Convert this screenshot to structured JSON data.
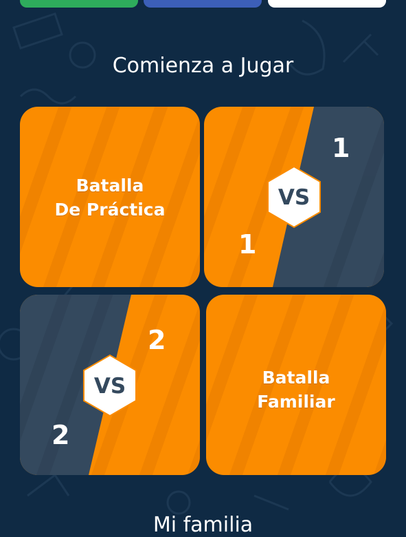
{
  "colors": {
    "background": "#0f2a44",
    "orange": "#fb8c00",
    "navy_panel": "#34495e",
    "green_button": "#2eac5c",
    "blue_button": "#3c5fb8",
    "white_button": "#ffffff"
  },
  "top_buttons": [
    "green",
    "blue",
    "white"
  ],
  "section_title": "Comienza a Jugar",
  "cards": {
    "practice": {
      "line1": "Batalla",
      "line2": "De Práctica"
    },
    "one_vs_one": {
      "badge": "VS",
      "top_number": "1",
      "bottom_number": "1"
    },
    "two_vs_two": {
      "badge": "VS",
      "top_number": "2",
      "bottom_number": "2"
    },
    "family": {
      "line1": "Batalla",
      "line2": "Familiar"
    }
  },
  "next_section_title": "Mi familia",
  "icons": [
    "vs-hexagon-icon",
    "music-instruments-pattern"
  ]
}
